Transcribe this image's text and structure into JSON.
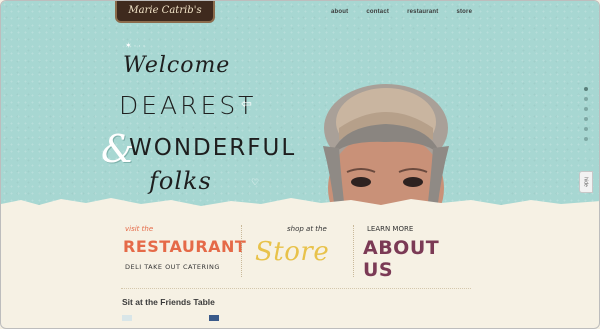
{
  "brand": {
    "logo_text": "Marie Catrib's"
  },
  "nav": {
    "items": [
      "about",
      "contact",
      "restaurant",
      "store"
    ]
  },
  "hero": {
    "line1": "Welcome",
    "line2": "DEAREST",
    "amp": "&",
    "line3": "WONDERFUL",
    "line4": "folks",
    "hide_label": "hide",
    "slide_count": 6,
    "active_slide": 1
  },
  "promos": [
    {
      "small": "visit the",
      "big": "RESTAURANT",
      "sub": "DELI TAKE OUT CATERING"
    },
    {
      "small": "shop at the",
      "big": "Store"
    },
    {
      "small": "LEARN MORE",
      "big": "ABOUT US"
    }
  ],
  "section": {
    "title": "Sit at the Friends Table"
  },
  "colors": {
    "hero_bg": "#a7d7d2",
    "paper": "#f6f1e4",
    "restaurant": "#e56a48",
    "store": "#e8c24a",
    "about": "#7b3a55"
  }
}
